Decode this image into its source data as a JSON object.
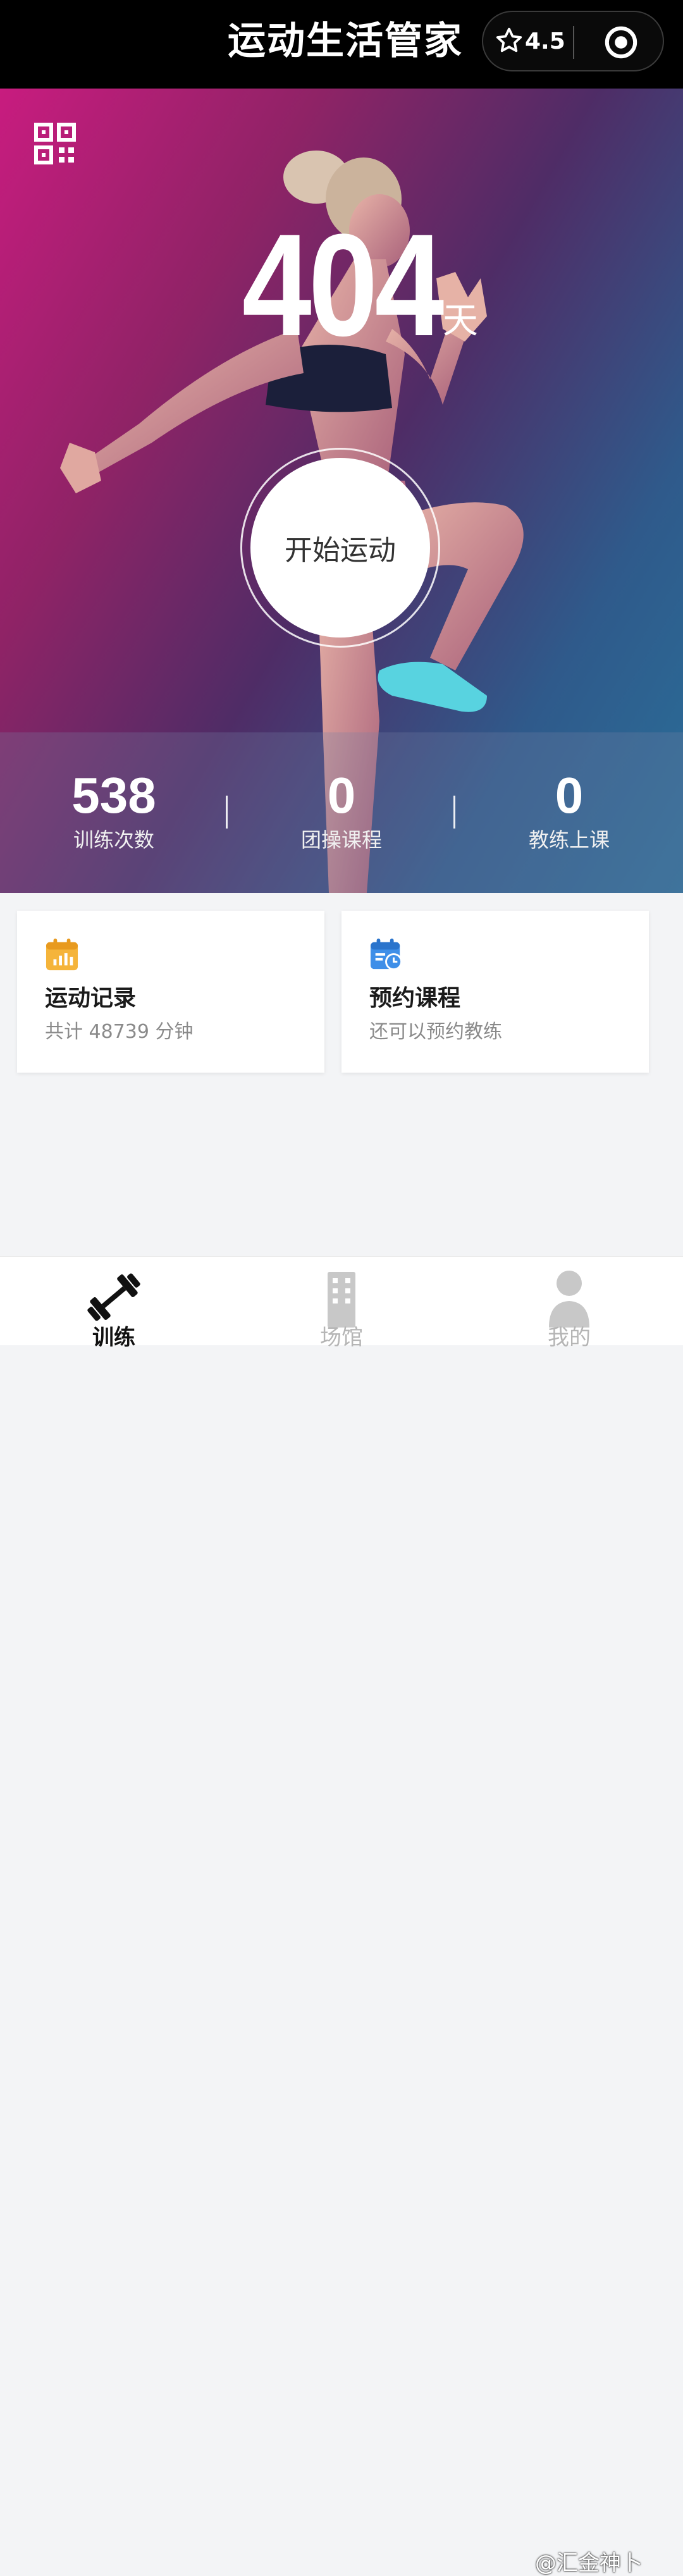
{
  "header": {
    "title": "运动生活管家",
    "rating": "4.5",
    "star_icon": "star-outline-icon",
    "target_icon": "target-icon"
  },
  "hero": {
    "qr_icon": "qr-code-icon",
    "days_count": "404",
    "days_unit": "天",
    "start_button": "开始运动",
    "stats": [
      {
        "value": "538",
        "label": "训练次数"
      },
      {
        "value": "0",
        "label": "团操课程"
      },
      {
        "value": "0",
        "label": "教练上课"
      }
    ]
  },
  "cards": [
    {
      "icon": "calendar-chart-icon",
      "title": "运动记录",
      "subtitle": "共计 48739 分钟",
      "icon_color": "#f5b43a"
    },
    {
      "icon": "calendar-clock-icon",
      "title": "预约课程",
      "subtitle": "还可以预约教练",
      "icon_color": "#3f8fe8"
    }
  ],
  "tabs": [
    {
      "label": "训练",
      "icon": "dumbbell-icon",
      "active": true
    },
    {
      "label": "场馆",
      "icon": "building-icon",
      "active": false
    },
    {
      "label": "我的",
      "icon": "user-icon",
      "active": false
    }
  ],
  "watermark": "@汇金神卜",
  "colors": {
    "hero_gradient_start": "#c81c7f",
    "hero_gradient_end": "#2a6f99",
    "topbar": "#000000",
    "page_bg": "#f3f4f6"
  }
}
